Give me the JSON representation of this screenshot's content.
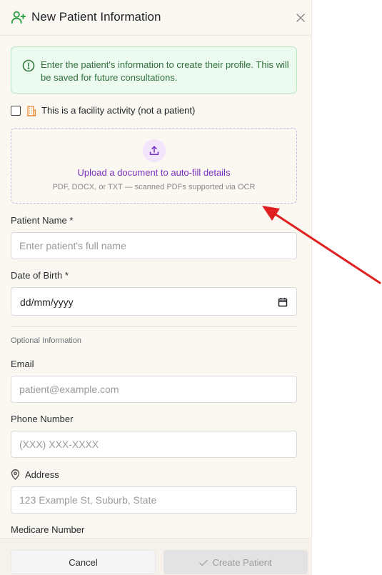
{
  "header": {
    "title": "New Patient Information",
    "icon": "user-plus-icon",
    "close_icon": "close-icon"
  },
  "notice": {
    "text": "Enter the patient's information to create their profile. This will be saved for future consultations.",
    "icon": "info-icon"
  },
  "facility": {
    "label": "This is a facility activity (not a patient)",
    "checked": false,
    "icon": "building-icon"
  },
  "upload": {
    "title": "Upload a document to auto-fill details",
    "subtitle": "PDF, DOCX, or TXT — scanned PDFs supported via OCR",
    "icon": "upload-icon"
  },
  "form": {
    "patient_name_label": "Patient Name *",
    "patient_name_placeholder": "Enter patient's full name",
    "dob_label": "Date of Birth *",
    "dob_value": "dd/mm/yyyy",
    "optional_heading": "Optional Information",
    "email_label": "Email",
    "email_placeholder": "patient@example.com",
    "phone_label": "Phone Number",
    "phone_placeholder": "(XXX) XXX-XXXX",
    "address_label": "Address",
    "address_placeholder": "123 Example St, Suburb, State",
    "medicare_label": "Medicare Number"
  },
  "footer": {
    "cancel_label": "Cancel",
    "create_label": "Create Patient"
  },
  "colors": {
    "accent_green": "#2f9e44",
    "accent_purple": "#7b2fc0",
    "annotation_red": "#e02020",
    "panel_bg": "#fbf7f1"
  }
}
